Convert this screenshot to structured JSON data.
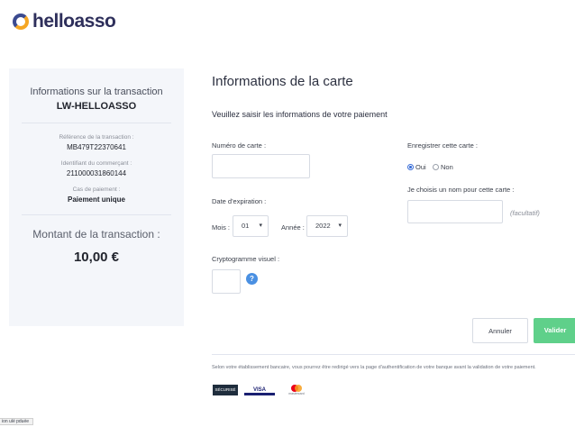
{
  "brand": {
    "name": "helloasso"
  },
  "transaction": {
    "heading": "Informations sur la transaction",
    "id": "LW-HELLOASSO",
    "ref_label": "Référence de la transaction :",
    "ref_value": "MB479T22370641",
    "merchant_label": "Identifiant du commerçant :",
    "merchant_value": "211000031860144",
    "payment_label": "Cas de paiement :",
    "payment_value": "Paiement unique",
    "amount_label": "Montant de la transaction :",
    "amount_value": "10,00 €"
  },
  "card_form": {
    "title": "Informations de la carte",
    "subtitle": "Veuillez saisir les informations de votre paiement",
    "card_number_label": "Numéro de carte :",
    "expiry_label": "Date d'expiration :",
    "month_label": "Mois :",
    "month_value": "01",
    "year_label": "Année :",
    "year_value": "2022",
    "cvv_label": "Cryptogramme visuel :",
    "save_card_label": "Enregistrer cette carte :",
    "yes_label": "Oui",
    "no_label": "Non",
    "card_name_label": "Je choisis un nom pour cette carte :",
    "optional_label": "(facultatif)"
  },
  "buttons": {
    "cancel": "Annuler",
    "validate": "Valider"
  },
  "footer": {
    "notice": "Selon votre établissement bancaire, vous pourrez être redirigé vers la page d'authentification de votre banque avant la validation de votre paiement.",
    "badges": [
      "SÉCURISÉ",
      "VISA",
      "mastercard"
    ]
  },
  "status_bar": "ion ulé pduée"
}
